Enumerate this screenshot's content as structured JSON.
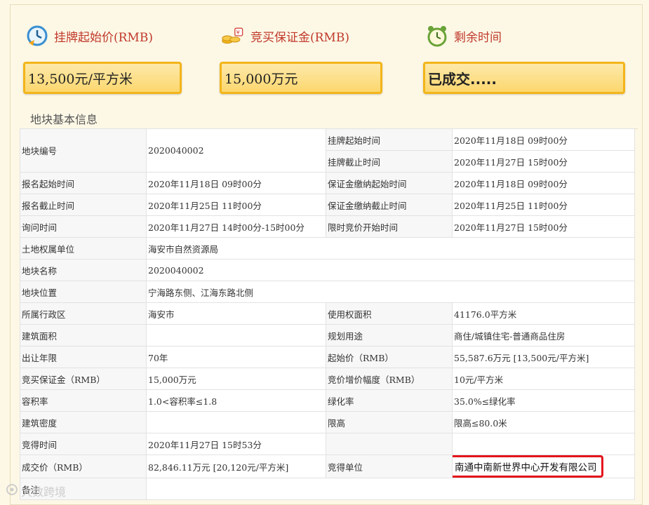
{
  "cards": [
    {
      "label": "挂牌起始价(RMB)",
      "value": "13,500元/平方米",
      "icon": "clock-icon"
    },
    {
      "label": "竞买保证金(RMB)",
      "value": "15,000万元",
      "icon": "coins-icon"
    },
    {
      "label": "剩余时间",
      "value": "已成交.....",
      "icon": "alarm-clock-icon"
    }
  ],
  "section_title": "地块基本信息",
  "table": {
    "parcel_no_label": "地块编号",
    "parcel_no": "2020040002",
    "listing_start_label": "挂牌起始时间",
    "listing_start": "2020年11月18日 09时00分",
    "listing_end_label": "挂牌截止时间",
    "listing_end": "2020年11月27日 15时00分",
    "reg_start_label": "报名起始时间",
    "reg_start": "2020年11月18日 09时00分",
    "deposit_start_label": "保证金缴纳起始时间",
    "deposit_start": "2020年11月18日 09时00分",
    "reg_end_label": "报名截止时间",
    "reg_end": "2020年11月25日 11时00分",
    "deposit_end_label": "保证金缴纳截止时间",
    "deposit_end": "2020年11月25日 11时00分",
    "inquiry_label": "询问时间",
    "inquiry": "2020年11月27日 14时00分-15时00分",
    "bid_start_label": "限时竞价开始时间",
    "bid_start": "2020年11月27日 15时00分",
    "owner_label": "土地权属单位",
    "owner": "海安市自然资源局",
    "name_label": "地块名称",
    "name": "2020040002",
    "location_label": "地块位置",
    "location": "宁海路东侧、江海东路北侧",
    "district_label": "所属行政区",
    "district": "海安市",
    "area_label": "使用权面积",
    "area": "41176.0平方米",
    "building_area_label": "建筑面积",
    "building_area": "",
    "usage_label": "规划用途",
    "usage": "商住/城镇住宅-普通商品住房",
    "term_label": "出让年限",
    "term": "70年",
    "start_price_label": "起始价（RMB）",
    "start_price": "55,587.6万元 [13,500元/平方米]",
    "deposit_label": "竞买保证金（RMB）",
    "deposit": "15,000万元",
    "increment_label": "竞价增价幅度（RMB）",
    "increment": "10元/平方米",
    "far_label": "容积率",
    "far": "1.0<容积率≤1.8",
    "green_label": "绿化率",
    "green": "35.0%≤绿化率",
    "density_label": "建筑密度",
    "density": "",
    "height_label": "限高",
    "height": "限高≤80.0米",
    "win_time_label": "竞得时间",
    "win_time": "2020年11月27日 15时53分",
    "deal_price_label": "成交价（RMB）",
    "deal_price": "82,846.11万元 [20,120元/平方米]",
    "winner_label": "竞得单位",
    "winner": "南通中南新世界中心开发有限公司",
    "remark_label": "备注",
    "remark": ""
  },
  "watermark": "大数跨境",
  "colors": {
    "accent": "#c0392b",
    "card_border": "#f3b51a",
    "highlight": "#e3141b"
  }
}
